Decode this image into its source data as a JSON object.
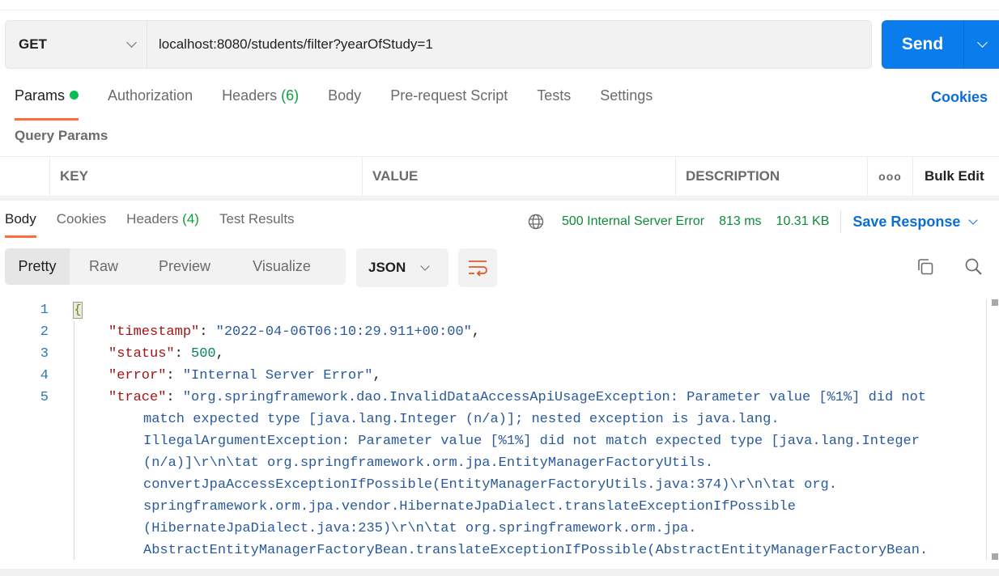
{
  "request": {
    "method": "GET",
    "url": "localhost:8080/students/filter?yearOfStudy=1",
    "send_label": "Send"
  },
  "request_tabs": [
    {
      "label": "Params",
      "badge": "",
      "active": true,
      "indicator": "green-dot"
    },
    {
      "label": "Authorization",
      "badge": ""
    },
    {
      "label": "Headers",
      "badge": "(6)"
    },
    {
      "label": "Body",
      "badge": ""
    },
    {
      "label": "Pre-request Script",
      "badge": ""
    },
    {
      "label": "Tests",
      "badge": ""
    },
    {
      "label": "Settings",
      "badge": ""
    }
  ],
  "cookies_link": "Cookies",
  "query_params": {
    "title": "Query Params",
    "columns": [
      "KEY",
      "VALUE",
      "DESCRIPTION"
    ],
    "more_icon": "ooo",
    "bulk_edit": "Bulk Edit"
  },
  "response_tabs": [
    {
      "label": "Body",
      "badge": "",
      "active": true
    },
    {
      "label": "Cookies",
      "badge": ""
    },
    {
      "label": "Headers",
      "badge": "(4)"
    },
    {
      "label": "Test Results",
      "badge": ""
    }
  ],
  "response_status": {
    "icon": "globe-icon",
    "status": "500 Internal Server Error",
    "time": "813 ms",
    "size": "10.31 KB",
    "save_response": "Save Response",
    "status_color": "#0e8a3a"
  },
  "format_bar": {
    "modes": [
      "Pretty",
      "Raw",
      "Preview",
      "Visualize"
    ],
    "active_mode": "Pretty",
    "language": "JSON",
    "wrap_icon": "wrap-lines-icon",
    "copy_icon": "copy-icon",
    "search_icon": "search-icon"
  },
  "code": {
    "line_numbers": [
      "1",
      "2",
      "3",
      "4",
      "5"
    ],
    "open_brace": "{",
    "timestamp_key": "\"timestamp\"",
    "timestamp_val": "\"2022-04-06T06:10:29.911+00:00\"",
    "status_key": "\"status\"",
    "status_val": "500",
    "error_key": "\"error\"",
    "error_val": "\"Internal Server Error\"",
    "trace_key": "\"trace\"",
    "trace_lines": [
      "\"org.springframework.dao.InvalidDataAccessApiUsageException: Parameter value [%1%] did not",
      "match expected type [java.lang.Integer (n/a)]; nested exception is java.lang.",
      "IllegalArgumentException: Parameter value [%1%] did not match expected type [java.lang.Integer",
      "(n/a)]\\r\\n\\tat org.springframework.orm.jpa.EntityManagerFactoryUtils.",
      "convertJpaAccessExceptionIfPossible(EntityManagerFactoryUtils.java:374)\\r\\n\\tat org.",
      "springframework.orm.jpa.vendor.HibernateJpaDialect.translateExceptionIfPossible",
      "(HibernateJpaDialect.java:235)\\r\\n\\tat org.springframework.orm.jpa.",
      "AbstractEntityManagerFactoryBean.translateExceptionIfPossible(AbstractEntityManagerFactoryBean."
    ]
  },
  "colors": {
    "accent_orange": "#ff6c37",
    "send_blue": "#0b7ceb",
    "link_blue": "#0b6fd1",
    "success_green": "#0cbb52"
  }
}
